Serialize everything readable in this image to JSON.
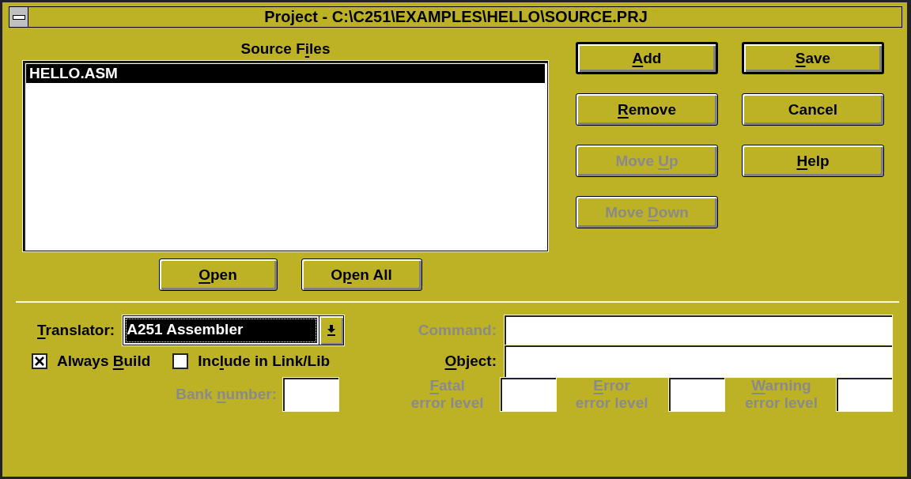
{
  "window": {
    "title": "Project - C:\\C251\\EXAMPLES\\HELLO\\SOURCE.PRJ"
  },
  "source_files": {
    "label": {
      "pre": "Source F",
      "key": "i",
      "post": "les"
    },
    "files": [
      {
        "name": "HELLO.ASM",
        "selected": true
      }
    ]
  },
  "action_buttons": [
    {
      "label": {
        "key": "A",
        "post": "dd"
      },
      "disabled": false,
      "default": true
    },
    {
      "label": {
        "key": "S",
        "post": "ave"
      },
      "disabled": false,
      "default": true
    },
    {
      "label": {
        "key": "R",
        "post": "emove"
      },
      "disabled": false,
      "default": false
    },
    {
      "label": {
        "pre": "Cancel"
      },
      "disabled": false,
      "default": false
    },
    {
      "label": {
        "pre": "Move ",
        "key": "U",
        "post": "p"
      },
      "disabled": true,
      "default": false
    },
    {
      "label": {
        "key": "H",
        "post": "elp"
      },
      "disabled": false,
      "default": false
    },
    {
      "label": {
        "pre": "Move ",
        "key": "D",
        "post": "own"
      },
      "disabled": true,
      "default": false
    }
  ],
  "list_buttons": [
    {
      "label": {
        "key": "O",
        "post": "pen"
      },
      "disabled": false
    },
    {
      "label": {
        "pre": "O",
        "key": "p",
        "post": "en All"
      },
      "disabled": false
    }
  ],
  "translator": {
    "label": {
      "key": "T",
      "post": "ranslator:"
    },
    "value": "A251 Assembler",
    "focused": true
  },
  "command": {
    "label": {
      "pre": "Command:"
    },
    "disabled": true
  },
  "options": [
    {
      "label": {
        "pre": "Always ",
        "key": "B",
        "post": "uild"
      },
      "checked": true
    },
    {
      "label": {
        "pre": "Inc",
        "key": "l",
        "post": "ude in Link/Lib"
      },
      "checked": false
    }
  ],
  "object": {
    "label": {
      "key": "O",
      "post": "bject:"
    },
    "disabled": false
  },
  "bank_number": {
    "label": {
      "pre": "Bank ",
      "key": "n",
      "post": "umber:"
    },
    "disabled": true
  },
  "error_levels": [
    {
      "label": {
        "key": "F",
        "post": "atal"
      },
      "second_line": "error level",
      "disabled": true
    },
    {
      "label": {
        "key": "E",
        "post": "rror"
      },
      "second_line": "error level",
      "disabled": true
    },
    {
      "label": {
        "key": "W",
        "post": "arning"
      },
      "second_line": "error level",
      "disabled": true
    }
  ]
}
